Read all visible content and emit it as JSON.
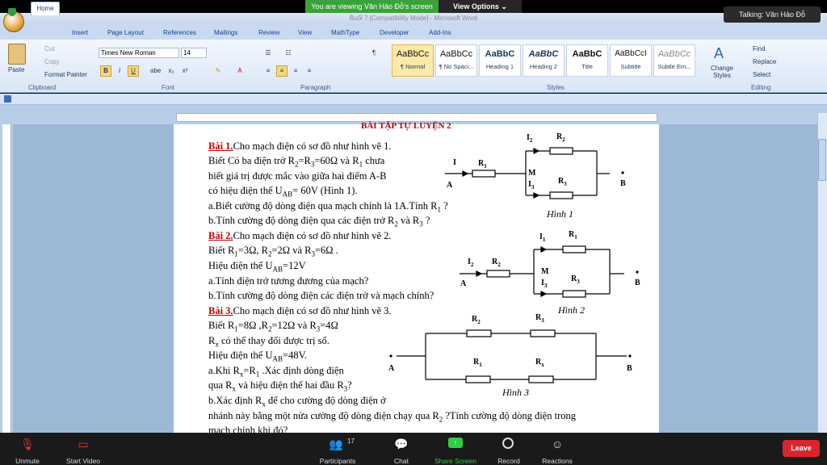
{
  "zoom_top": {
    "viewing_banner": "You are viewing Văn Hảo Đỗ's screen",
    "view_options": "View Options ⌄",
    "talking": "Talking: Văn Hảo Đỗ"
  },
  "word": {
    "window_title": "Buổi 7 [Compatibility Mode] - Microsoft Word",
    "tabs": [
      "Home",
      "Insert",
      "Page Layout",
      "References",
      "Mailings",
      "Review",
      "View",
      "MathType",
      "Developer",
      "Add-Ins"
    ],
    "clipboard": {
      "paste": "Paste",
      "cut": "Cut",
      "copy": "Copy",
      "format_painter": "Format Painter",
      "label": "Clipboard"
    },
    "font": {
      "family": "Times New Roman",
      "size": "14",
      "label": "Font"
    },
    "paragraph": {
      "label": "Paragraph"
    },
    "styles": {
      "items": [
        {
          "preview": "AaBbCc",
          "name": "¶ Normal"
        },
        {
          "preview": "AaBbCc",
          "name": "¶ No Spaci..."
        },
        {
          "preview": "AaBbC",
          "name": "Heading 1"
        },
        {
          "preview": "AaBbC",
          "name": "Heading 2"
        },
        {
          "preview": "AaBbC",
          "name": "Title"
        },
        {
          "preview": "AaBbCcI",
          "name": "Subtitle"
        },
        {
          "preview": "AaBbCc",
          "name": "Subtle Em..."
        }
      ],
      "change_styles": "Change Styles",
      "label": "Styles"
    },
    "editing": {
      "find": "Find",
      "replace": "Replace",
      "select": "Select",
      "label": "Editing"
    }
  },
  "document": {
    "header_cut": "BÀI TẬP TỰ LUYỆN 2",
    "bai1": {
      "title": "Bài 1.",
      "intro": "Cho mạch điện có sơ đồ như hình vẽ 1."
    },
    "bai2": {
      "title": "Bài 2.",
      "intro": "Cho mạch điện có sơ đồ như hình vẽ 2."
    },
    "bai3": {
      "title": "Bài 3.",
      "intro": "Cho mạch điện có sơ đồ như hình vẽ 3."
    },
    "captions": {
      "h1": "Hình 1",
      "h2": "Hình 2",
      "h3": "Hình 3"
    }
  },
  "zoom_bottom": {
    "unmute": "Unmute",
    "start_video": "Start Video",
    "participants": "Participants",
    "participant_count": "17",
    "chat": "Chat",
    "share_screen": "Share Screen",
    "record": "Record",
    "reactions": "Reactions",
    "leave": "Leave"
  },
  "colors": {
    "share_green": "#2ecc40",
    "leave_red": "#d9262c",
    "title_red": "#c00000"
  }
}
